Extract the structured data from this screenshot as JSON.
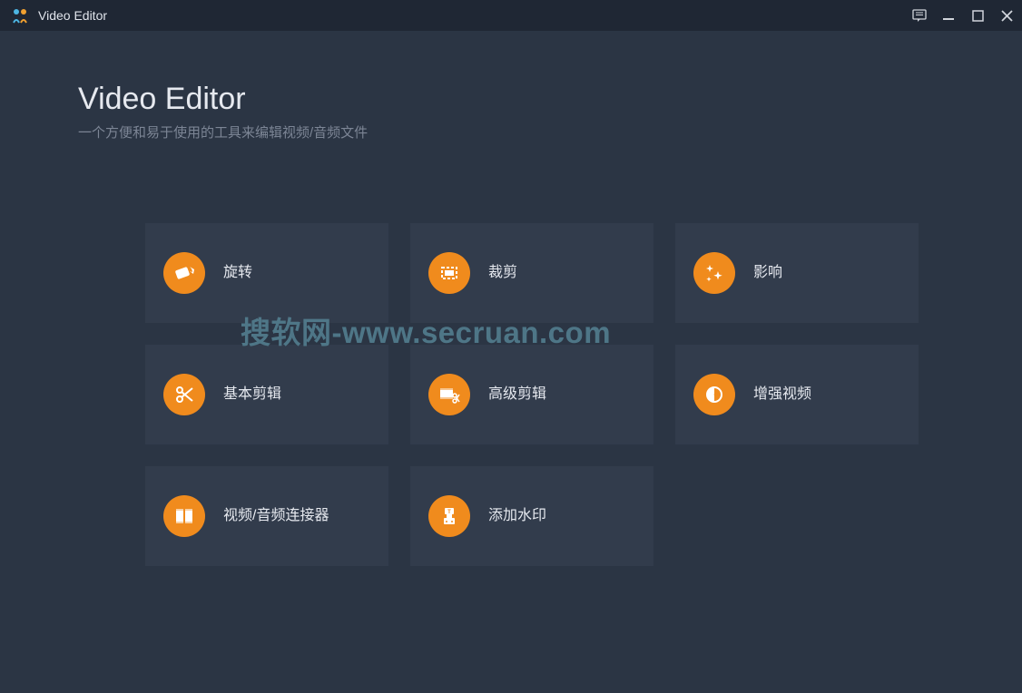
{
  "titlebar": {
    "title": "Video Editor"
  },
  "header": {
    "title": "Video Editor",
    "subtitle": "一个方便和易于使用的工具来编辑视频/音频文件"
  },
  "tools": [
    {
      "label": "旋转",
      "icon": "rotate-icon"
    },
    {
      "label": "裁剪",
      "icon": "crop-icon"
    },
    {
      "label": "影响",
      "icon": "effects-icon"
    },
    {
      "label": "基本剪辑",
      "icon": "basic-clip-icon"
    },
    {
      "label": "高级剪辑",
      "icon": "advanced-clip-icon"
    },
    {
      "label": "增强视频",
      "icon": "enhance-icon"
    },
    {
      "label": "视频/音频连接器",
      "icon": "joiner-icon"
    },
    {
      "label": "添加水印",
      "icon": "watermark-icon"
    }
  ],
  "watermark_text": "搜软网-www.secruan.com",
  "colors": {
    "bg": "#2b3544",
    "card": "#323c4c",
    "accent": "#f08b1d",
    "titlebar": "#1f2734"
  }
}
